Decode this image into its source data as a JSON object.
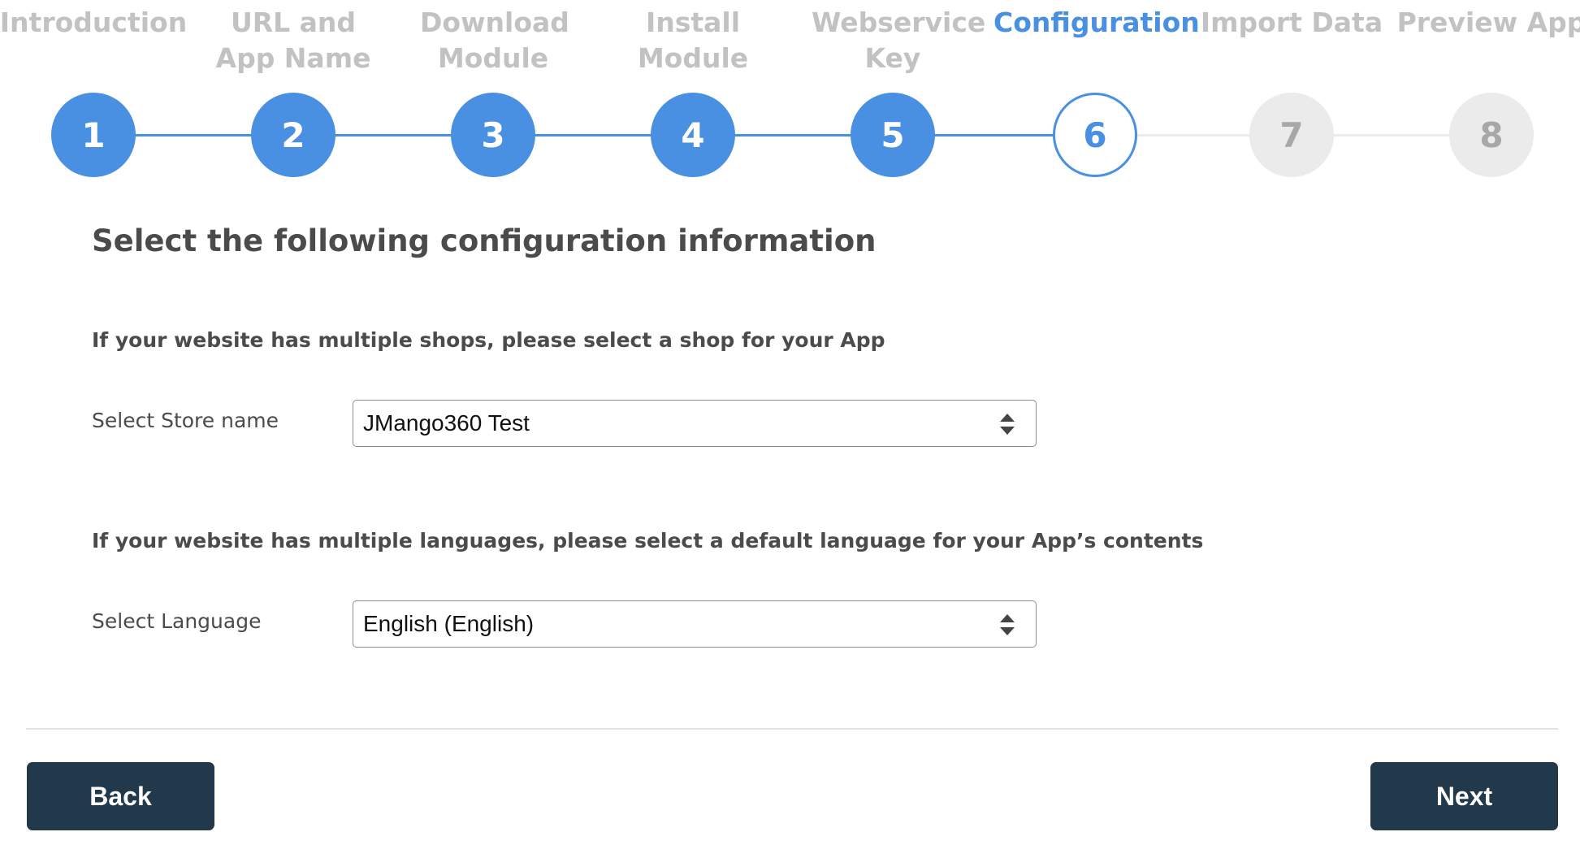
{
  "stepper": {
    "steps": [
      {
        "label": "Introduction",
        "number": "1",
        "state": "done"
      },
      {
        "label": "URL and App Name",
        "number": "2",
        "state": "done"
      },
      {
        "label": "Download Module",
        "number": "3",
        "state": "done"
      },
      {
        "label": "Install Module",
        "number": "4",
        "state": "done"
      },
      {
        "label": "Webservice Key",
        "number": "5",
        "state": "done"
      },
      {
        "label": "Configuration",
        "number": "6",
        "state": "current"
      },
      {
        "label": "Import Data",
        "number": "7",
        "state": "todo"
      },
      {
        "label": "Preview App",
        "number": "8",
        "state": "todo"
      }
    ]
  },
  "main": {
    "heading": "Select the following configuration information",
    "shop_section": {
      "text": "If your website has multiple shops, please select a shop for your App",
      "field_label": "Select Store name",
      "selected_value": "JMango360 Test"
    },
    "language_section": {
      "text": "If your website has multiple languages, please select a default language for your App’s contents",
      "field_label": "Select Language",
      "selected_value": "English (English)"
    }
  },
  "footer": {
    "back_label": "Back",
    "next_label": "Next"
  },
  "colors": {
    "accent": "#4a90e2",
    "inactive_circle": "#ebebeb",
    "inactive_text": "#c2c2c2",
    "button_bg": "#22394b"
  }
}
